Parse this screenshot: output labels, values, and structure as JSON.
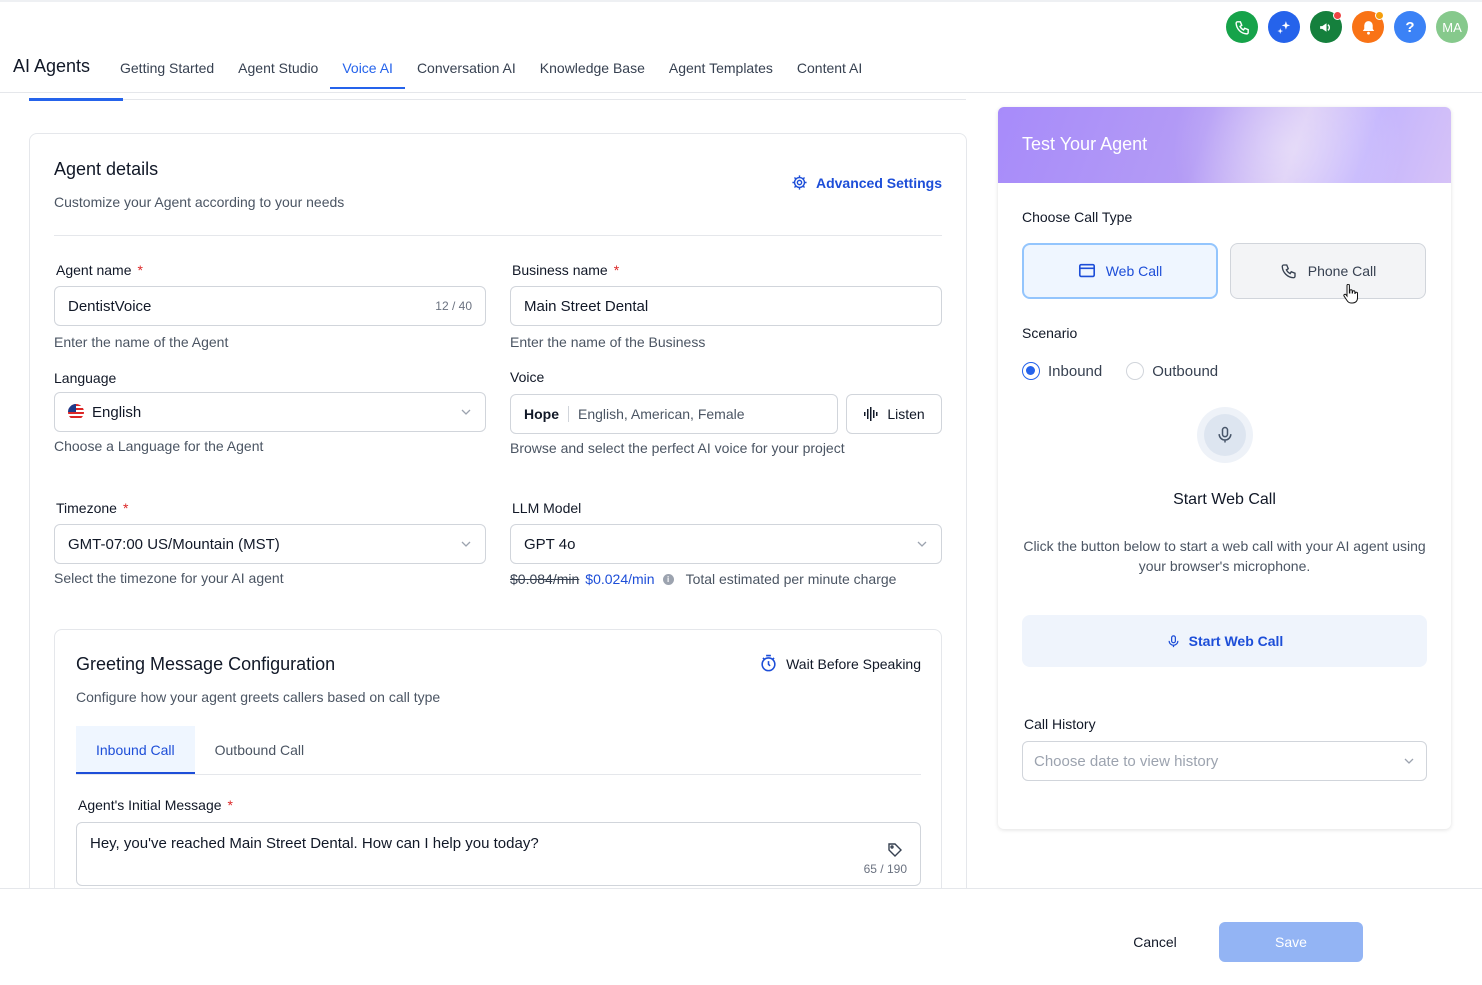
{
  "header": {
    "avatar_initials": "MA",
    "help_glyph": "?",
    "icons": [
      "phone-icon",
      "sparkle-icon",
      "megaphone-icon",
      "bell-icon",
      "help-icon"
    ],
    "colors": {
      "phone": "#16a34a",
      "sparkle": "#2563eb",
      "megaphone": "#15803d",
      "bell": "#f97316",
      "help": "#3b82f6",
      "avatar": "#86c98c"
    }
  },
  "nav": {
    "brand": "AI Agents",
    "tabs": [
      "Getting Started",
      "Agent Studio",
      "Voice AI",
      "Conversation AI",
      "Knowledge Base",
      "Agent Templates",
      "Content AI"
    ],
    "active_tab": "Voice AI"
  },
  "agent_details": {
    "title": "Agent details",
    "subtitle": "Customize your Agent according to your needs",
    "advanced_settings": "Advanced Settings",
    "agent_name": {
      "label": "Agent name",
      "required": "*",
      "value": "DentistVoice",
      "counter": "12 / 40",
      "help": "Enter the name of the Agent"
    },
    "business_name": {
      "label": "Business name",
      "required": "*",
      "value": "Main Street Dental",
      "help": "Enter the name of the Business"
    },
    "language": {
      "label": "Language",
      "value": "English",
      "help": "Choose a Language for the Agent"
    },
    "voice": {
      "label": "Voice",
      "name": "Hope",
      "description": "English, American, Female",
      "listen": "Listen",
      "help": "Browse and select the perfect AI voice for your project"
    },
    "timezone": {
      "label": "Timezone",
      "required": "*",
      "value": "GMT-07:00 US/Mountain (MST)",
      "help": "Select the timezone for your AI agent"
    },
    "llm_model": {
      "label": "LLM Model",
      "value": "GPT 4o",
      "old_price": "$0.084/min",
      "new_price": "$0.024/min",
      "info": "i",
      "price_note": "Total estimated per minute charge"
    }
  },
  "greeting": {
    "title": "Greeting Message Configuration",
    "subtitle": "Configure how your agent greets callers based on call type",
    "wait_before_speaking": "Wait Before Speaking",
    "tabs": [
      "Inbound Call",
      "Outbound Call"
    ],
    "active_tab": "Inbound Call",
    "initial_message_label": "Agent's Initial Message",
    "required": "*",
    "initial_message": "Hey, you've reached Main Street Dental. How can I help you today?",
    "counter": "65 / 190"
  },
  "test_panel": {
    "title": "Test Your Agent",
    "choose_call_type": "Choose Call Type",
    "call_types": {
      "web": "Web Call",
      "phone": "Phone Call"
    },
    "selected_call_type": "Web Call",
    "scenario_label": "Scenario",
    "scenarios": {
      "inbound": "Inbound",
      "outbound": "Outbound"
    },
    "selected_scenario": "Inbound",
    "start_title": "Start Web Call",
    "start_description": "Click the button below to start a web call with your AI agent using your browser's microphone.",
    "start_button": "Start Web Call",
    "call_history_label": "Call History",
    "call_history_placeholder": "Choose date to view history"
  },
  "footer": {
    "cancel": "Cancel",
    "save": "Save"
  }
}
